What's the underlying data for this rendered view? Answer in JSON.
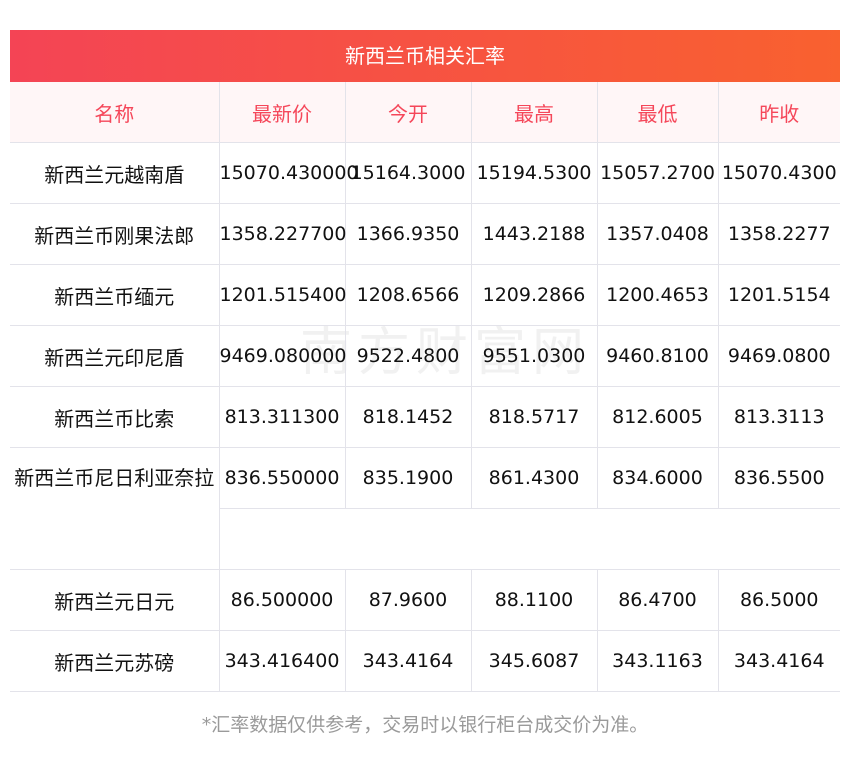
{
  "title": "新西兰币相关汇率",
  "headers": [
    "名称",
    "最新价",
    "今开",
    "最高",
    "最低",
    "昨收"
  ],
  "rows": [
    [
      "新西兰元越南盾",
      "15070.430000",
      "15164.3000",
      "15194.5300",
      "15057.2700",
      "15070.4300"
    ],
    [
      "新西兰币刚果法郎",
      "1358.227700",
      "1366.9350",
      "1443.2188",
      "1357.0408",
      "1358.2277"
    ],
    [
      "新西兰币缅元",
      "1201.515400",
      "1208.6566",
      "1209.2866",
      "1200.4653",
      "1201.5154"
    ],
    [
      "新西兰元印尼盾",
      "9469.080000",
      "9522.4800",
      "9551.0300",
      "9460.8100",
      "9469.0800"
    ],
    [
      "新西兰币比索",
      "813.311300",
      "818.1452",
      "818.5717",
      "812.6005",
      "813.3113"
    ],
    [
      "新西兰币尼日利亚奈拉",
      "836.550000",
      "835.1900",
      "861.4300",
      "834.6000",
      "836.5500"
    ],
    [
      "新西兰元日元",
      "86.500000",
      "87.9600",
      "88.1100",
      "86.4700",
      "86.5000"
    ],
    [
      "新西兰元苏磅",
      "343.416400",
      "343.4164",
      "345.6087",
      "343.1163",
      "343.4164"
    ]
  ],
  "watermark": "南方财富网 southmoney.com",
  "note": "*汇率数据仅供参考，交易时以银行柜台成交价为准。"
}
